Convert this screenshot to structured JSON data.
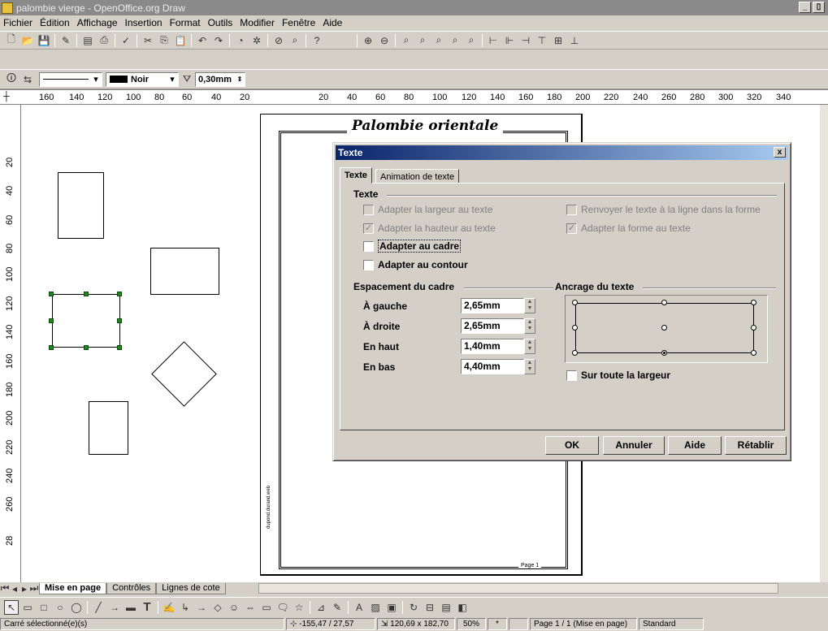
{
  "window": {
    "title": "palombie vierge - OpenOffice.org Draw",
    "btn_min": "_",
    "btn_max": "▯",
    "btn_close": "x"
  },
  "menu": [
    "Fichier",
    "Édition",
    "Affichage",
    "Insertion",
    "Format",
    "Outils",
    "Modifier",
    "Fenêtre",
    "Aide"
  ],
  "line_toolbar": {
    "color_name": "Noir",
    "line_width": "0,30mm"
  },
  "ruler_h": [
    "160",
    "140",
    "120",
    "100",
    "80",
    "60",
    "40",
    "20",
    "20",
    "40",
    "60",
    "80",
    "100",
    "120",
    "140",
    "160",
    "180",
    "200",
    "220",
    "240",
    "260",
    "280",
    "300",
    "320",
    "340"
  ],
  "ruler_v": [
    "20",
    "40",
    "60",
    "80",
    "100",
    "120",
    "140",
    "160",
    "180",
    "200",
    "220",
    "240",
    "260",
    "28"
  ],
  "page": {
    "heading": "Palombie orientale",
    "footer": "Page 1",
    "side_text": "dupond.durand.web"
  },
  "dialog": {
    "title": "Texte",
    "close": "x",
    "tabs": [
      "Texte",
      "Animation de texte"
    ],
    "text_group": "Texte",
    "checkboxes": [
      {
        "label": "Adapter la largeur au texte",
        "checked": "",
        "disabled": true
      },
      {
        "label": "Adapter la hauteur au texte",
        "checked": "✓",
        "disabled": true
      },
      {
        "label": "Adapter au cadre",
        "checked": "",
        "disabled": false
      },
      {
        "label": "Adapter au contour",
        "checked": "",
        "disabled": false
      },
      {
        "label": "Renvoyer le texte à la ligne dans la forme",
        "checked": "",
        "disabled": true
      },
      {
        "label": "Adapter la forme au texte",
        "checked": "✓",
        "disabled": true
      }
    ],
    "spacing_group": "Espacement du cadre",
    "spacing": [
      {
        "label": "À gauche",
        "value": "2,65mm"
      },
      {
        "label": "À droite",
        "value": "2,65mm"
      },
      {
        "label": "En haut",
        "value": "1,40mm"
      },
      {
        "label": "En bas",
        "value": "4,40mm"
      }
    ],
    "anchor_group": "Ancrage du texte",
    "anchor_selected": "bottom-center",
    "full_width": "Sur toute la largeur",
    "buttons": {
      "ok": "OK",
      "cancel": "Annuler",
      "help": "Aide",
      "reset": "Rétablir"
    }
  },
  "sheet_tabs": [
    "Mise en page",
    "Contrôles",
    "Lignes de cote"
  ],
  "status": {
    "selection": "Carré sélectionné(e)(s)",
    "position": "-155,47 / 27,57",
    "size": "120,69 x 182,70",
    "zoom": "50%",
    "modified": "*",
    "page": "Page 1 / 1 (Mise en page)",
    "style": "Standard"
  },
  "colors": {
    "accent_red": "#e01e1e",
    "title_gradient_start": "#0a246a",
    "handle_green": "#1a8a1a"
  }
}
